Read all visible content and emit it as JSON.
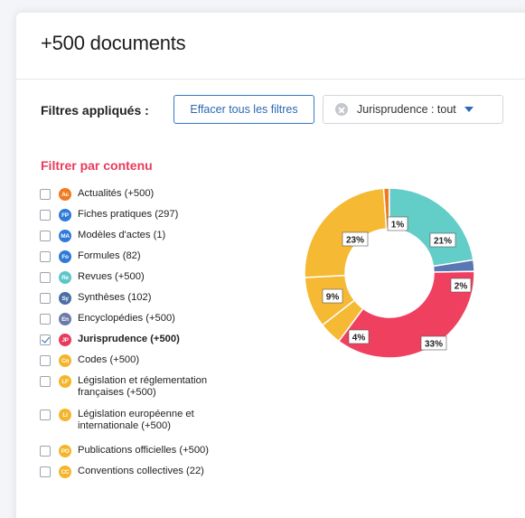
{
  "header": {
    "title": "+500 documents"
  },
  "filters": {
    "label": "Filtres appliqués :",
    "clear_label": "Effacer tous les filtres",
    "chip_label": "Jurisprudence : tout"
  },
  "content_filter": {
    "title": "Filtrer par contenu",
    "items": [
      {
        "label": "Actualités (+500)",
        "badge": "Ac",
        "color": "#f07a22",
        "checked": false
      },
      {
        "label": "Fiches pratiques (297)",
        "badge": "FP",
        "color": "#2f7ad8",
        "checked": false
      },
      {
        "label": "Modèles d'actes (1)",
        "badge": "MA",
        "color": "#2f7ad8",
        "checked": false
      },
      {
        "label": "Formules (82)",
        "badge": "Fo",
        "color": "#2f7ad8",
        "checked": false
      },
      {
        "label": "Revues (+500)",
        "badge": "Re",
        "color": "#5cc6c8",
        "checked": false
      },
      {
        "label": "Synthèses (102)",
        "badge": "Sy",
        "color": "#4a6fa5",
        "checked": false
      },
      {
        "label": "Encyclopédies (+500)",
        "badge": "En",
        "color": "#6b7ba8",
        "checked": false
      },
      {
        "label": "Jurisprudence (+500)",
        "badge": "JP",
        "color": "#ea3a5b",
        "checked": true
      },
      {
        "label": "Codes (+500)",
        "badge": "Co",
        "color": "#f5b52a",
        "checked": false
      },
      {
        "label": "Législation et réglementation",
        "label2": "françaises (+500)",
        "badge": "LF",
        "color": "#f5b52a",
        "checked": false
      },
      {
        "label": "Législation européenne et",
        "label2": "internationale (+500)",
        "badge": "LI",
        "color": "#f5b52a",
        "checked": false
      },
      {
        "label": "Publications officielles (+500)",
        "badge": "PO",
        "color": "#f5b52a",
        "checked": false
      },
      {
        "label": "Conventions collectives (22)",
        "badge": "CC",
        "color": "#f5b52a",
        "checked": false
      }
    ]
  },
  "chart_data": {
    "type": "pie",
    "donut": true,
    "slices": [
      {
        "value": 1,
        "label": "1%",
        "color": "#f07a22"
      },
      {
        "value": 21,
        "label": "21%",
        "color": "#63cdc8"
      },
      {
        "value": 2,
        "label": "2%",
        "color": "#5b77b3"
      },
      {
        "value": 33,
        "label": "33%",
        "color": "#ef4060"
      },
      {
        "value": 4,
        "label": "4%",
        "color": "#f6b934"
      },
      {
        "value": 9,
        "label": "9%",
        "color": "#f6b934"
      },
      {
        "value": 23,
        "label": "23%",
        "color": "#f6b934"
      }
    ]
  }
}
